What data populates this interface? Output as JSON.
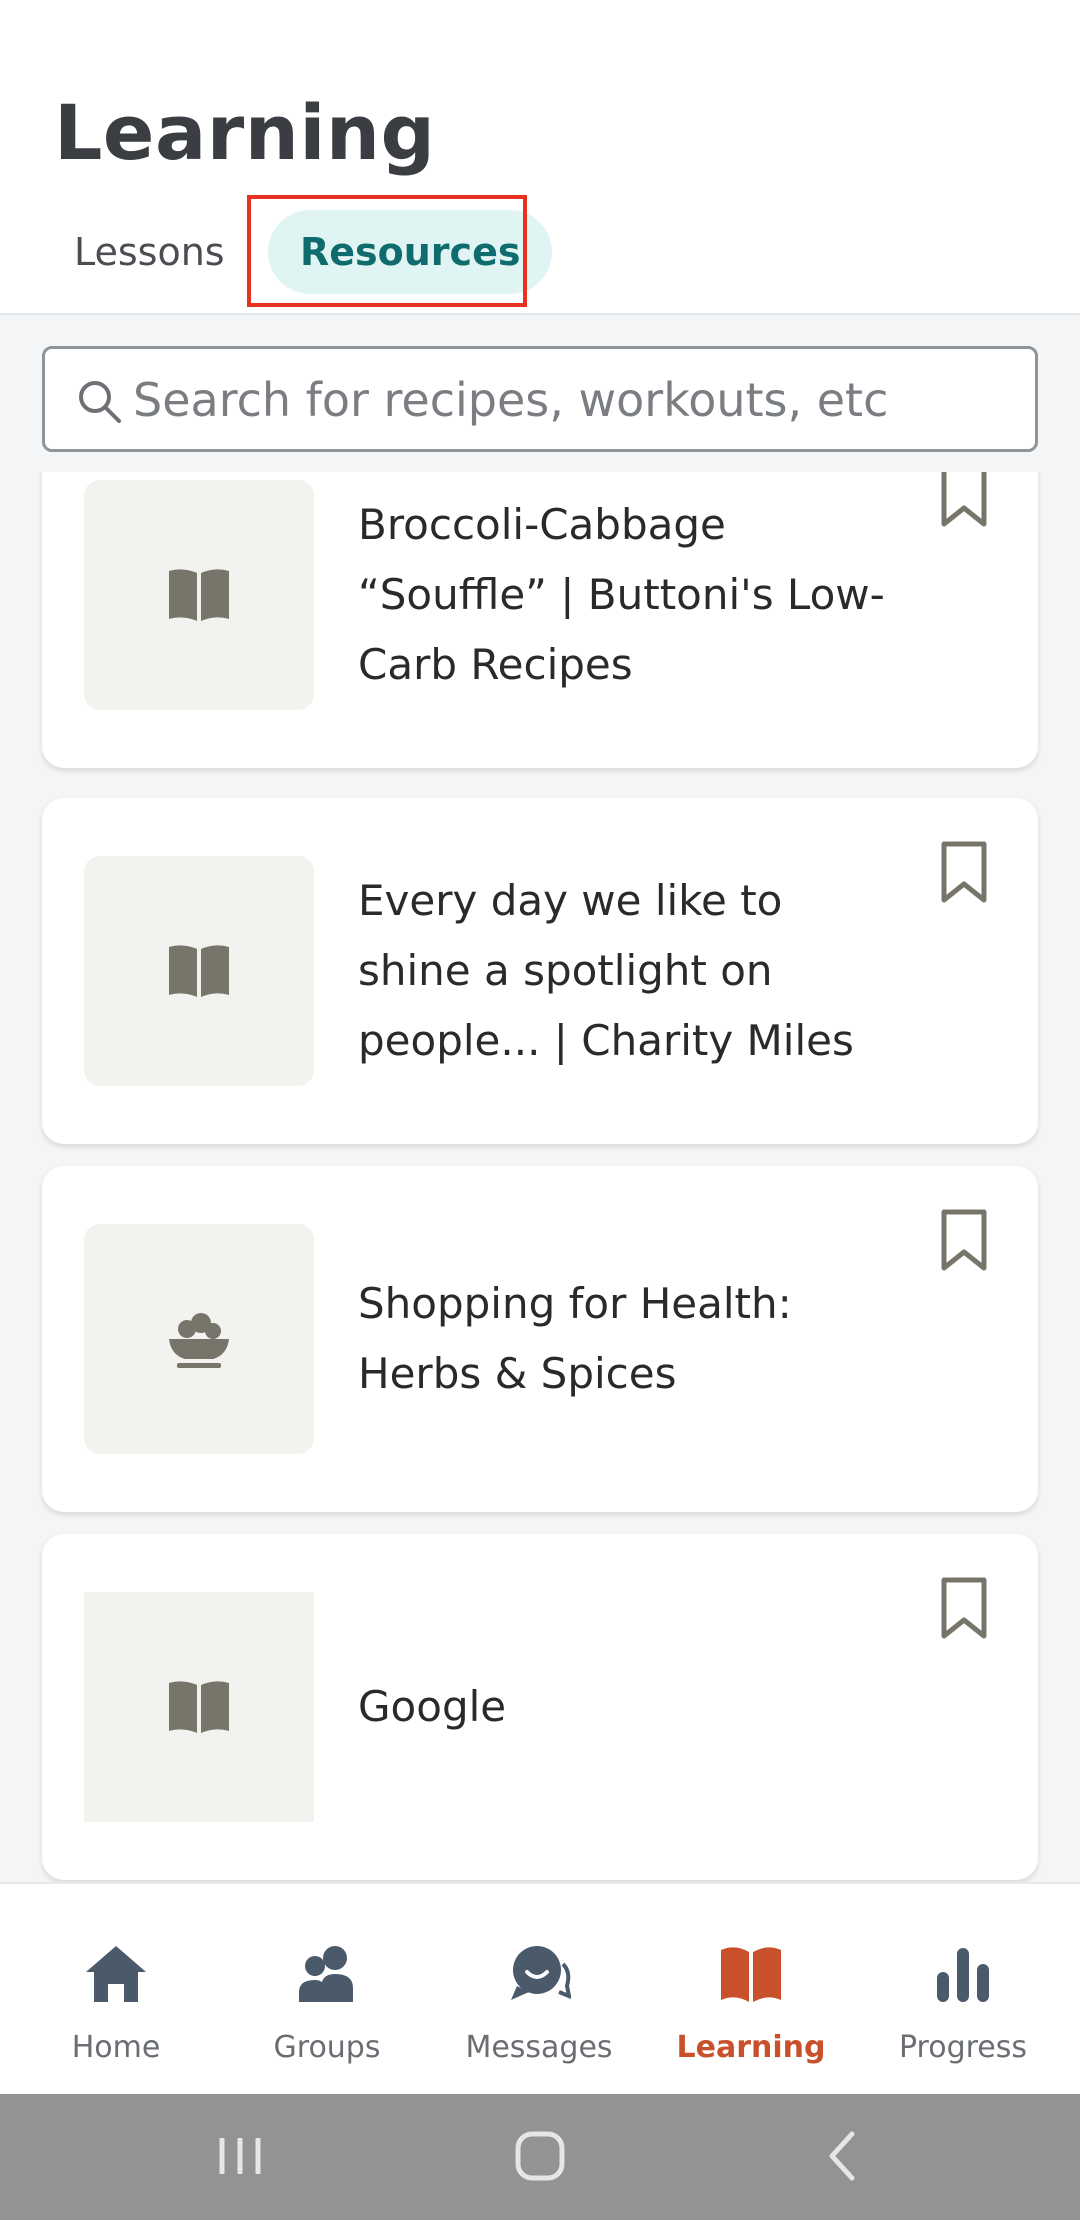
{
  "header": {
    "title": "Learning",
    "tabs": [
      {
        "label": "Lessons",
        "active": false
      },
      {
        "label": "Resources",
        "active": true
      }
    ]
  },
  "search": {
    "placeholder": "Search for recipes, workouts, etc",
    "value": ""
  },
  "resources": [
    {
      "title": "Broccoli-Cabbage “Souffle” | Buttoni's Low-Carb Recipes",
      "icon": "book-icon"
    },
    {
      "title": "Every day we like to shine a spotlight on people... | Charity Miles",
      "icon": "book-icon"
    },
    {
      "title": "Shopping for Health: Herbs & Spices",
      "icon": "food-bowl-icon"
    },
    {
      "title": "Google",
      "icon": "book-icon"
    }
  ],
  "nav": {
    "items": [
      {
        "label": "Home",
        "icon": "home-icon"
      },
      {
        "label": "Groups",
        "icon": "groups-icon"
      },
      {
        "label": "Messages",
        "icon": "messages-icon"
      },
      {
        "label": "Learning",
        "icon": "learning-icon",
        "active": true
      },
      {
        "label": "Progress",
        "icon": "progress-icon"
      }
    ]
  },
  "colors": {
    "accent": "#c8502a",
    "tab_active_bg": "#dff4f3",
    "tab_active_text": "#0f6b6d",
    "highlight": "#e8321f"
  }
}
